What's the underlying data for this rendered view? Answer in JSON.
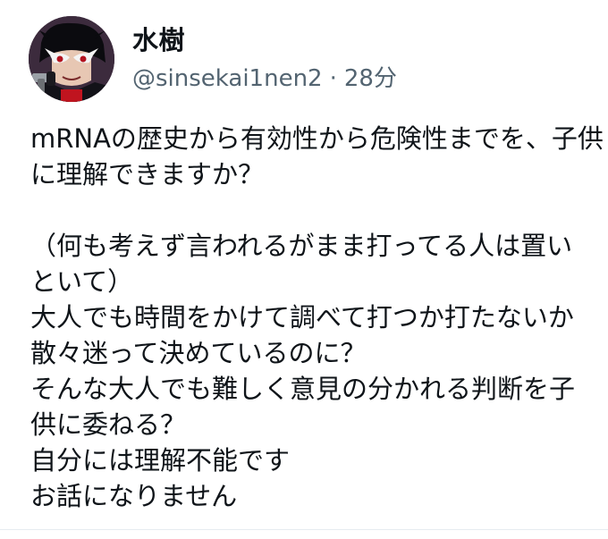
{
  "author": {
    "display_name": "水樹",
    "handle": "@sinsekai1nen2",
    "separator": "·",
    "time_ago": "28分",
    "avatar_icon": "avatar-masked-character-icon"
  },
  "tweet": {
    "lines": [
      "mRNAの歴史から有効性から危険性までを、子供",
      "に理解できますか？",
      "",
      "（何も考えず言われるがまま打ってる人は置い",
      "といて）",
      "大人でも時間をかけて調べて打つか打たないか",
      "散々迷って決めているのに？",
      "そんな大人でも難しく意見の分かれる判断を子",
      "供に委ねる？",
      "自分には理解不能です",
      "お話になりません"
    ]
  },
  "colors": {
    "text_primary": "#0f1419",
    "text_secondary": "#536471",
    "background": "#ffffff",
    "divider": "#e6ecf0"
  }
}
